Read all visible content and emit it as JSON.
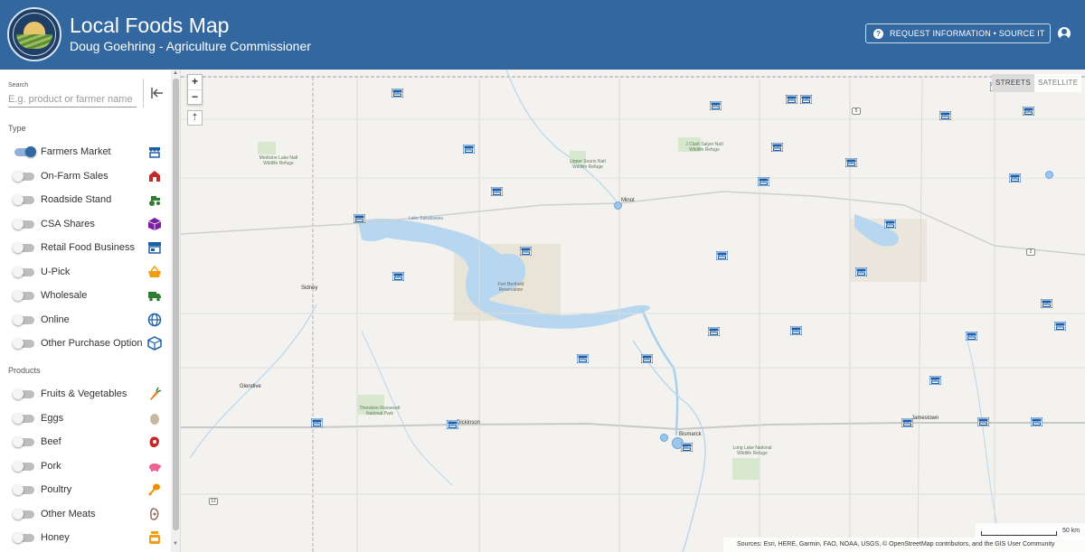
{
  "header": {
    "title": "Local Foods Map",
    "subtitle": "Doug Goehring - Agriculture Commissioner",
    "request_button": "REQUEST INFORMATION • SOURCE IT",
    "seal_text": "NORTH DAKOTA DEPARTMENT OF AGRICULTURE"
  },
  "search": {
    "label": "Search",
    "placeholder": "E.g. product or farmer name"
  },
  "type_section": {
    "title": "Type",
    "items": [
      {
        "label": "Farmers Market",
        "on": true,
        "icon": "market-stall-icon",
        "color": "#1d5ea8"
      },
      {
        "label": "On-Farm Sales",
        "on": false,
        "icon": "barn-icon",
        "color": "#c62828"
      },
      {
        "label": "Roadside Stand",
        "on": false,
        "icon": "tractor-icon",
        "color": "#2e7d32"
      },
      {
        "label": "CSA Shares",
        "on": false,
        "icon": "box-icon",
        "color": "#7b1fa2"
      },
      {
        "label": "Retail Food Business",
        "on": false,
        "icon": "storefront-icon",
        "color": "#1d5ea8"
      },
      {
        "label": "U-Pick",
        "on": false,
        "icon": "basket-icon",
        "color": "#f39c12"
      },
      {
        "label": "Wholesale",
        "on": false,
        "icon": "truck-icon",
        "color": "#2e7d32"
      },
      {
        "label": "Online",
        "on": false,
        "icon": "globe-icon",
        "color": "#1d5ea8"
      },
      {
        "label": "Other Purchase Option",
        "on": false,
        "icon": "package-icon",
        "color": "#1d5ea8"
      }
    ]
  },
  "products_section": {
    "title": "Products",
    "items": [
      {
        "label": "Fruits & Vegetables",
        "on": false,
        "icon": "carrot-icon",
        "color": "#e67e22"
      },
      {
        "label": "Eggs",
        "on": false,
        "icon": "egg-icon",
        "color": "#c7b7a3"
      },
      {
        "label": "Beef",
        "on": false,
        "icon": "beef-icon",
        "color": "#c62828"
      },
      {
        "label": "Pork",
        "on": false,
        "icon": "pig-icon",
        "color": "#f06292"
      },
      {
        "label": "Poultry",
        "on": false,
        "icon": "drumstick-icon",
        "color": "#ef8f00"
      },
      {
        "label": "Other Meats",
        "on": false,
        "icon": "meat-icon",
        "color": "#8d6e63"
      },
      {
        "label": "Honey",
        "on": false,
        "icon": "honey-jar-icon",
        "color": "#f39c12"
      }
    ]
  },
  "map": {
    "basemap_options": [
      "STREETS",
      "SATELLITE"
    ],
    "selected_basemap": "STREETS",
    "zoom_in": "+",
    "zoom_out": "−",
    "compass": "⇡",
    "attribution": "Sources: Esri, HERE, Garmin, FAO, NOAA, USGS, © OpenStreetMap contributors, and the GIS User Community",
    "scale_label": "50 km",
    "cities": [
      "Minot",
      "Sidney",
      "Glendive",
      "Dickinson",
      "Bismarck",
      "Jamestown"
    ],
    "places": [
      "Medicine Lake Natl Wildlife Refuge",
      "Upper Souris Natl Wildlife Refuge",
      "J Clark Salyer Natl Wildlife Refuge",
      "Lake Sakakawea",
      "Fort Berthold Reservation",
      "Theodore Roosevelt National Park",
      "Long Lake National Wildlife Refuge"
    ],
    "route_shields": [
      "5",
      "2",
      "12"
    ],
    "marker_icon": "market-stall-icon",
    "marker_color": "#1d5ea8"
  }
}
